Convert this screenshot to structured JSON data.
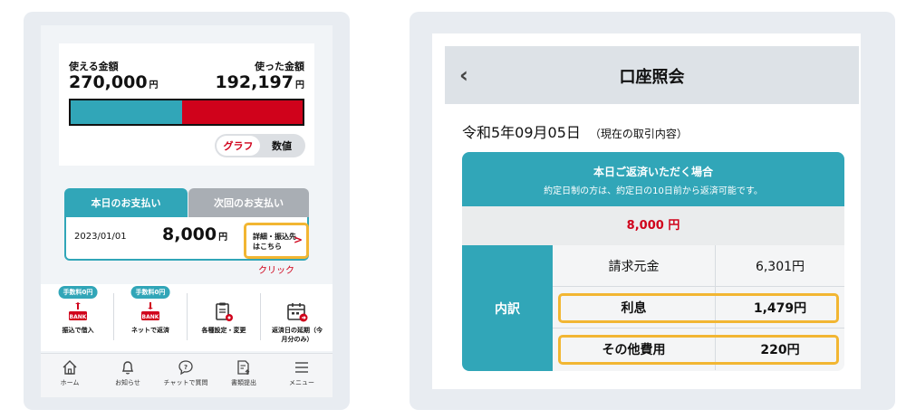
{
  "left": {
    "balance": {
      "usable_label": "使える金額",
      "usable_amount": "270,000",
      "used_label": "使った金額",
      "used_amount": "192,197",
      "yen": "円",
      "usage_ratio": 0.48,
      "colors": {
        "usable": "#31a6b8",
        "used": "#d0021b"
      }
    },
    "toggle": {
      "graph": "グラフ",
      "number": "数値",
      "selected": "グラフ"
    },
    "payment": {
      "tab_today": "本日のお支払い",
      "tab_next": "次回のお支払い",
      "date": "2023/01/01",
      "amount": "8,000",
      "yen": "円",
      "detail_line1": "詳細・振込先",
      "detail_line2": "はこちら",
      "click_note": "クリック"
    },
    "menu": [
      {
        "fee_badge": "手数料0円",
        "icon": "bank-transfer-icon",
        "label": "振込で借入"
      },
      {
        "fee_badge": "手数料0円",
        "icon": "bank-net-icon",
        "label": "ネットで返済"
      },
      {
        "icon": "document-settings-icon",
        "label": "各種設定・変更"
      },
      {
        "icon": "calendar-extend-icon",
        "label_line1": "返済日の延期（今",
        "label_line2": "月分のみ）"
      }
    ],
    "nav": [
      {
        "icon": "home-icon",
        "label": "ホーム"
      },
      {
        "icon": "bell-icon",
        "label": "お知らせ"
      },
      {
        "icon": "chat-question-icon",
        "label": "チャットで質問"
      },
      {
        "icon": "document-upload-icon",
        "label": "書類提出"
      },
      {
        "icon": "menu-icon",
        "label": "メニュー"
      }
    ]
  },
  "right": {
    "header": {
      "back": "‹",
      "title": "口座照会"
    },
    "date": "令和5年09月05日",
    "date_note": "（現在の取引内容）",
    "card": {
      "title": "本日ご返済いただく場合",
      "subtitle": "約定日制の方は、約定日の10日前から返済可能です。",
      "total": "8,000 円",
      "breakdown_label": "内訳",
      "rows": [
        {
          "name": "請求元金",
          "value": "6,301円",
          "highlight": false
        },
        {
          "name": "利息",
          "value": "1,479円",
          "highlight": true
        },
        {
          "name": "その他費用",
          "value": "220円",
          "highlight": true
        }
      ],
      "highlight_color": "#f2b632"
    }
  }
}
